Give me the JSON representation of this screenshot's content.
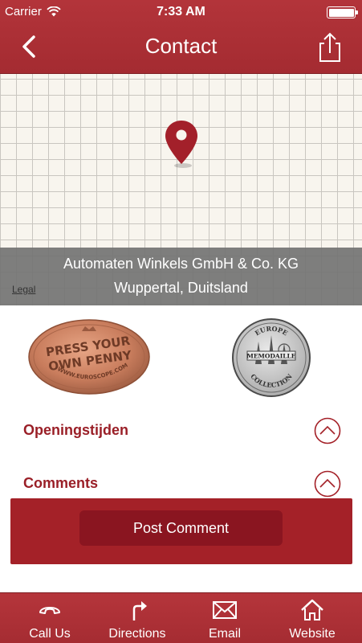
{
  "status_bar": {
    "carrier": "Carrier",
    "time": "7:33 AM"
  },
  "nav": {
    "title": "Contact",
    "back_icon": "chevron-left-icon",
    "share_icon": "share-icon"
  },
  "map": {
    "address_line1": "Automaten Winkels GmbH & Co. KG",
    "address_line2": "Wuppertal, Duitsland",
    "legal": "Legal"
  },
  "logos": {
    "penny": {
      "line1": "PRESS YOUR",
      "line2": "OWN PENNY",
      "arc": "WWW.EUROSCOPE.COM"
    },
    "memodaille": {
      "top": "EUROPE",
      "banner": "MEMODAILLE",
      "bottom": "COLLECTION"
    }
  },
  "sections": [
    {
      "label": "Openingstijden"
    },
    {
      "label": "Comments"
    }
  ],
  "comments": {
    "post_label": "Post Comment"
  },
  "tabbar": {
    "items": [
      {
        "label": "Call Us",
        "icon": "phone-icon"
      },
      {
        "label": "Directions",
        "icon": "directions-icon"
      },
      {
        "label": "Email",
        "icon": "envelope-icon"
      },
      {
        "label": "Website",
        "icon": "home-icon"
      }
    ]
  },
  "colors": {
    "brand": "#a42b31",
    "accent_text": "#9a1f27",
    "button": "#8a1520"
  }
}
